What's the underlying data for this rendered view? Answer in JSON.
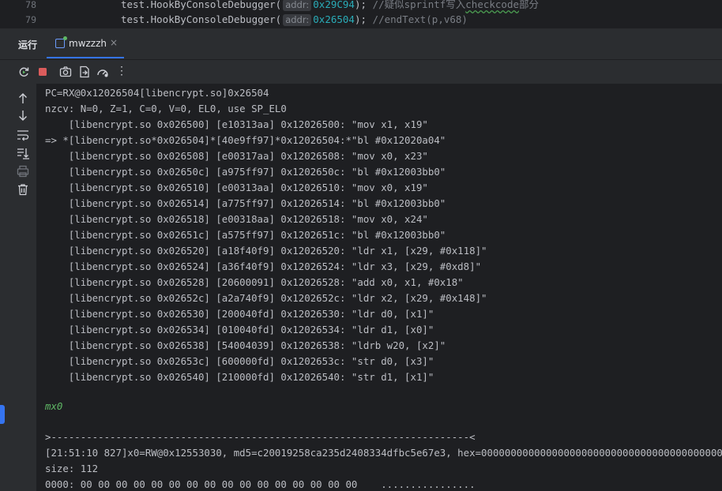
{
  "editor": {
    "lines": [
      {
        "num": "78",
        "call": "test.HookByConsoleDebugger(",
        "hint": "addr:",
        "arg": "0x29C94",
        "end": ");",
        "comment_pre": "//疑似sprintf写入",
        "comment_squig": "checkcode",
        "comment_post": "部分"
      },
      {
        "num": "79",
        "call": "test.HookByConsoleDebugger(",
        "hint": "addr:",
        "arg": "0x26504",
        "end": ");",
        "comment_pre": "//endText(p,v68)",
        "comment_squig": "",
        "comment_post": ""
      }
    ]
  },
  "run_panel": {
    "label": "运行",
    "tab_label": "mwzzzh",
    "close_glyph": "×"
  },
  "toolbar": {
    "icons": [
      "rerun-icon",
      "stop-icon",
      "screenshot-icon",
      "export-icon",
      "dashboard-icon",
      "more-icon"
    ],
    "more_glyph": "⋮"
  },
  "sidebar": {
    "icons": [
      "scroll-up-icon",
      "scroll-down-icon",
      "soft-wrap-icon",
      "scroll-to-end-icon",
      "print-icon",
      "clear-icon"
    ]
  },
  "console": {
    "lines": [
      "PC=RX@0x12026504[libencrypt.so]0x26504",
      "nzcv: N=0, Z=1, C=0, V=0, EL0, use SP_EL0",
      "    [libencrypt.so 0x026500] [e10313aa] 0x12026500: \"mov x1, x19\"",
      "=> *[libencrypt.so*0x026504]*[40e9ff97]*0x12026504:*\"bl #0x12020a04\"",
      "    [libencrypt.so 0x026508] [e00317aa] 0x12026508: \"mov x0, x23\"",
      "    [libencrypt.so 0x02650c] [a975ff97] 0x1202650c: \"bl #0x12003bb0\"",
      "    [libencrypt.so 0x026510] [e00313aa] 0x12026510: \"mov x0, x19\"",
      "    [libencrypt.so 0x026514] [a775ff97] 0x12026514: \"bl #0x12003bb0\"",
      "    [libencrypt.so 0x026518] [e00318aa] 0x12026518: \"mov x0, x24\"",
      "    [libencrypt.so 0x02651c] [a575ff97] 0x1202651c: \"bl #0x12003bb0\"",
      "    [libencrypt.so 0x026520] [a18f40f9] 0x12026520: \"ldr x1, [x29, #0x118]\"",
      "    [libencrypt.so 0x026524] [a36f40f9] 0x12026524: \"ldr x3, [x29, #0xd8]\"",
      "    [libencrypt.so 0x026528] [20600091] 0x12026528: \"add x0, x1, #0x18\"",
      "    [libencrypt.so 0x02652c] [a2a740f9] 0x1202652c: \"ldr x2, [x29, #0x148]\"",
      "    [libencrypt.so 0x026530] [200040fd] 0x12026530: \"ldr d0, [x1]\"",
      "    [libencrypt.so 0x026534] [010040fd] 0x12026534: \"ldr d1, [x0]\"",
      "    [libencrypt.so 0x026538] [54004039] 0x12026538: \"ldrb w20, [x2]\"",
      "    [libencrypt.so 0x02653c] [600000fd] 0x1202653c: \"str d0, [x3]\"",
      "    [libencrypt.so 0x026540] [210000fd] 0x12026540: \"str d1, [x1]\"",
      "",
      "mx0",
      "",
      ">-----------------------------------------------------------------------<",
      "[21:51:10 827]x0=RW@0x12553030, md5=c20019258ca235d2408334dfbc5e67e3, hex=000000000000000000000000000000000000000000",
      "size: 112",
      "0000: 00 00 00 00 00 00 00 00 00 00 00 00 00 00 00 00    ................"
    ]
  }
}
